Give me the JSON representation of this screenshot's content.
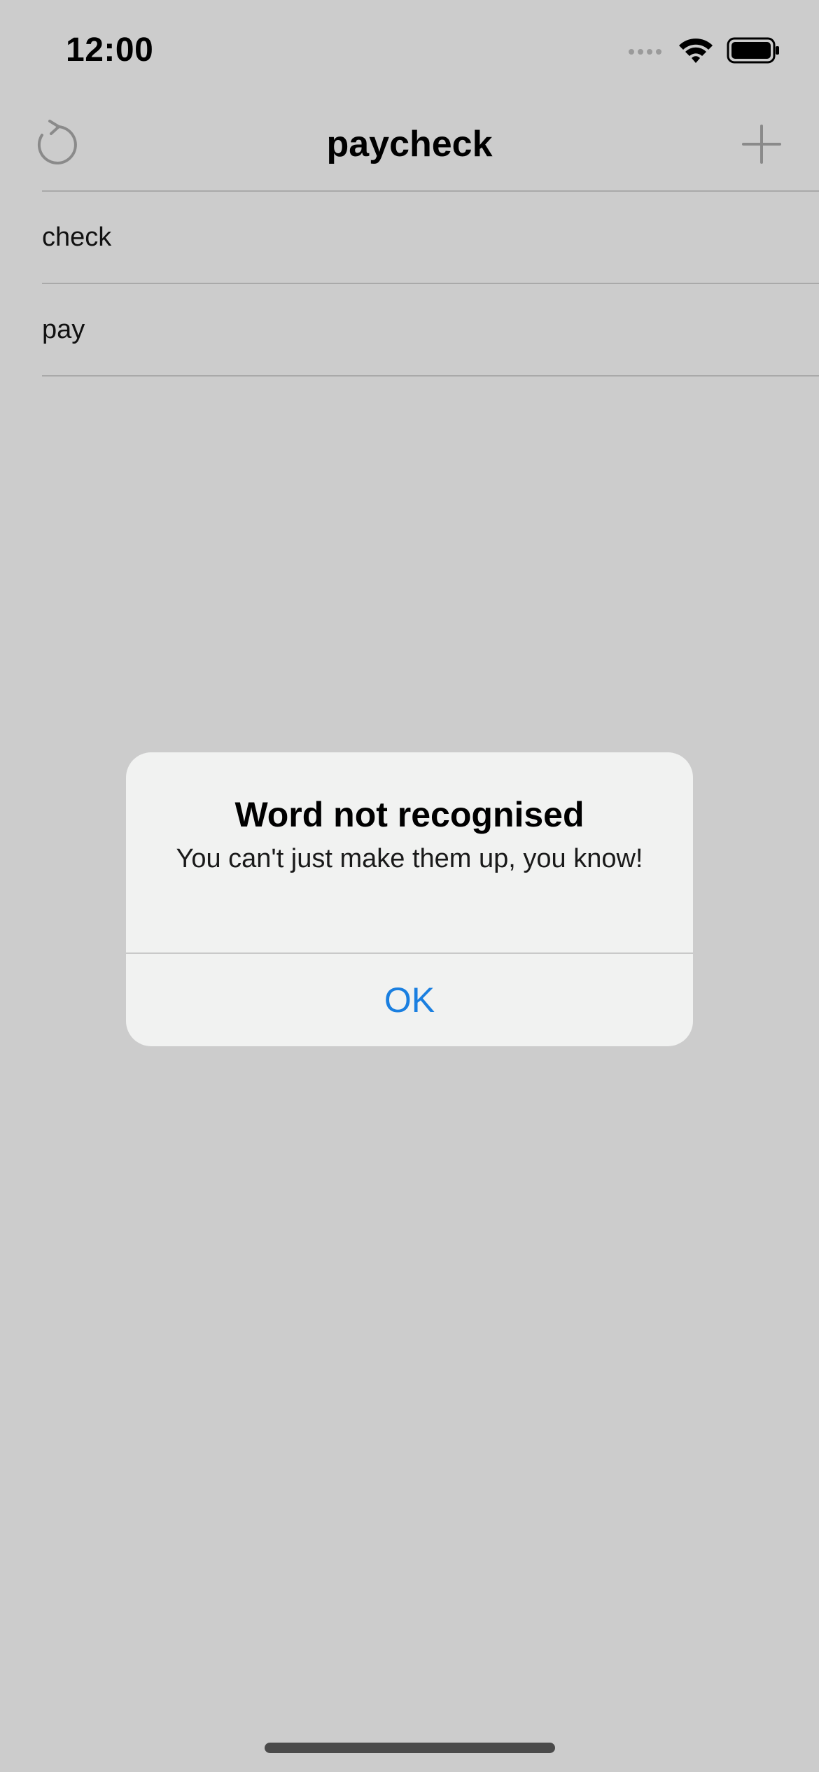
{
  "status_bar": {
    "time": "12:00",
    "icons": [
      "signal-icon",
      "wifi-icon",
      "battery-icon"
    ]
  },
  "nav": {
    "title": "paycheck",
    "left_icon": "refresh-icon",
    "right_icon": "plus-icon"
  },
  "words": [
    {
      "label": "check"
    },
    {
      "label": "pay"
    }
  ],
  "alert": {
    "title": "Word not recognised",
    "message": "You can't just make them up, you know!",
    "button_label": "OK"
  },
  "colors": {
    "background": "#cccccc",
    "alert_background": "#f1f2f1",
    "accent": "#1a7fe0",
    "icon_gray": "#8a8a8a"
  }
}
